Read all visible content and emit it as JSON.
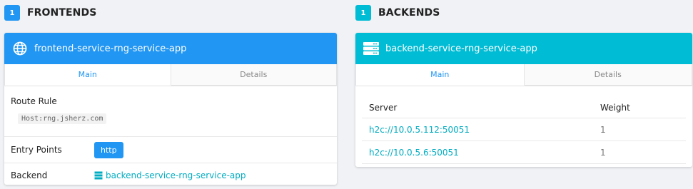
{
  "frontends": {
    "count": "1",
    "title": "FRONTENDS",
    "card": {
      "name": "frontend-service-rng-service-app",
      "tabs": [
        "Main",
        "Details"
      ],
      "route_rule_label": "Route Rule",
      "route_rule_value": "Host:rng.jsherz.com",
      "entry_points_label": "Entry Points",
      "entry_points": [
        "http"
      ],
      "backend_label": "Backend",
      "backend_value": "backend-service-rng-service-app"
    }
  },
  "backends": {
    "count": "1",
    "title": "BACKENDS",
    "card": {
      "name": "backend-service-rng-service-app",
      "tabs": [
        "Main",
        "Details"
      ],
      "columns": [
        "Server",
        "Weight"
      ],
      "servers": [
        {
          "url": "h2c://10.0.5.112:50051",
          "weight": "1"
        },
        {
          "url": "h2c://10.0.5.6:50051",
          "weight": "1"
        }
      ]
    }
  },
  "icons": {
    "frontend_header": "globe-icon",
    "backend_header": "server-icon",
    "backend_link": "server-icon"
  },
  "colors": {
    "frontend_accent": "#2196f3",
    "backend_accent": "#00bcd4",
    "link": "#00acc1"
  }
}
